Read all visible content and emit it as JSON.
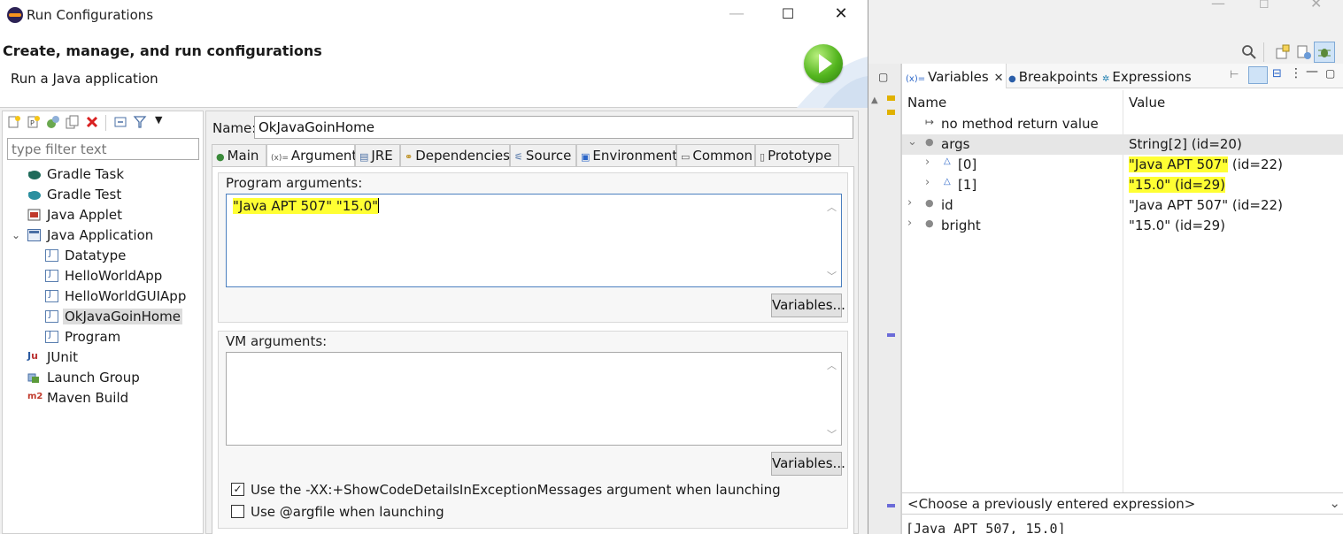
{
  "dialog": {
    "title": "Run Configurations",
    "banner_title": "Create, manage, and run configurations",
    "banner_subtitle": "Run a Java application"
  },
  "left_panel": {
    "filter_placeholder": "type filter text",
    "tree": [
      {
        "label": "Gradle Task",
        "icon": "gradle-elephant-icon"
      },
      {
        "label": "Gradle Test",
        "icon": "gradle-elephant-icon"
      },
      {
        "label": "Java Applet",
        "icon": "applet-icon"
      },
      {
        "label": "Java Application",
        "icon": "java-app-icon",
        "expanded": true
      },
      {
        "label": "Datatype",
        "icon": "java-file-icon"
      },
      {
        "label": "HelloWorldApp",
        "icon": "java-file-icon"
      },
      {
        "label": "HelloWorldGUIApp",
        "icon": "java-file-icon"
      },
      {
        "label": "OkJavaGoinHome",
        "icon": "java-file-icon",
        "selected": true
      },
      {
        "label": "Program",
        "icon": "java-file-icon"
      },
      {
        "label": "JUnit",
        "icon": "junit-icon"
      },
      {
        "label": "Launch Group",
        "icon": "launch-group-icon"
      },
      {
        "label": "Maven Build",
        "icon": "maven-icon"
      }
    ]
  },
  "config": {
    "name_label": "Name:",
    "name_value": "OkJavaGoinHome",
    "tabs": [
      {
        "label": "Main"
      },
      {
        "label": "Arguments",
        "active": true
      },
      {
        "label": "JRE"
      },
      {
        "label": "Dependencies"
      },
      {
        "label": "Source"
      },
      {
        "label": "Environment"
      },
      {
        "label": "Common"
      },
      {
        "label": "Prototype"
      }
    ],
    "program_args_label": "Program arguments:",
    "program_args_value": "\"Java APT 507\" \"15.0\"",
    "variables_button": "Variables...",
    "vm_args_label": "VM arguments:",
    "vm_args_value": "",
    "checkbox_show_code": "Use the -XX:+ShowCodeDetailsInExceptionMessages argument when launching",
    "checkbox_show_code_checked": true,
    "checkbox_argfile": "Use @argfile when launching",
    "checkbox_argfile_checked": false
  },
  "variables_view": {
    "tabs": [
      {
        "label": "Variables",
        "active": true
      },
      {
        "label": "Breakpoints"
      },
      {
        "label": "Expressions"
      }
    ],
    "columns": {
      "name": "Name",
      "value": "Value"
    },
    "rows": [
      {
        "name": "no method return value",
        "value": ""
      },
      {
        "name": "args",
        "value": "String[2]  (id=20)"
      },
      {
        "name": "[0]",
        "value_hl": "\"Java APT 507\"",
        "value": " (id=22)"
      },
      {
        "name": "[1]",
        "value_hl": "\"15.0\" (id=29)",
        "value": ""
      },
      {
        "name": "id",
        "value": "\"Java APT 507\" (id=22)"
      },
      {
        "name": "bright",
        "value": "\"15.0\" (id=29)"
      }
    ],
    "expression_placeholder": "<Choose a previously entered expression>",
    "detail_text": "[Java APT 507, 15.0]"
  },
  "colors": {
    "highlight": "#ffff33",
    "selection": "#dcdcdc",
    "run_icon": "#53b51e"
  }
}
